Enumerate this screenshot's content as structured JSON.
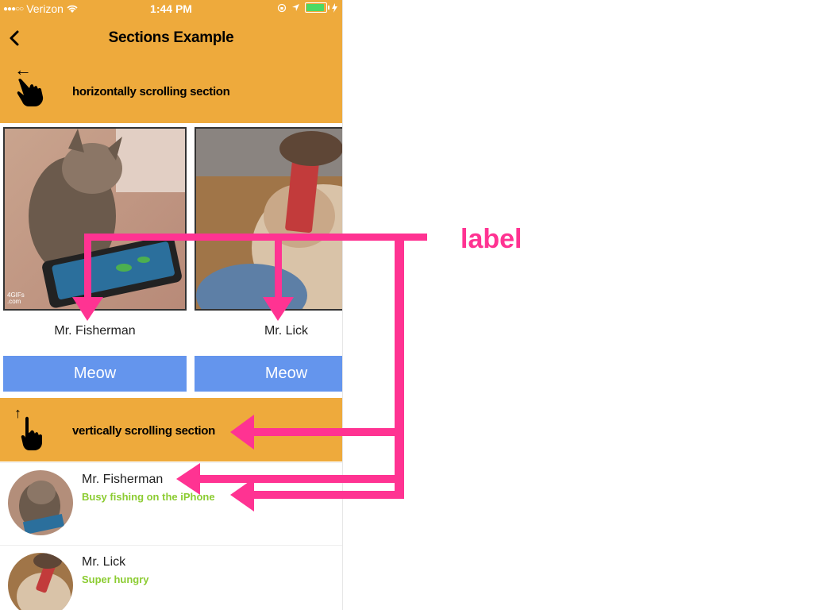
{
  "status_bar": {
    "carrier": "Verizon",
    "time": "1:44 PM",
    "icons": [
      "signal-dots-icon",
      "wifi-icon",
      "location-icon",
      "rotation-lock-icon",
      "battery-icon",
      "charging-icon"
    ]
  },
  "nav": {
    "title": "Sections Example",
    "back_icon": "chevron-left-icon"
  },
  "sections": {
    "horizontal": {
      "title": "horizontally scrolling section",
      "arrow": "←",
      "icon": "hand-swipe-icon"
    },
    "vertical": {
      "title": "vertically scrolling section",
      "arrow": "↑",
      "icon": "hand-swipe-icon"
    }
  },
  "cards": [
    {
      "name": "Mr. Fisherman",
      "button": "Meow",
      "watermark": "4GIFs\n.com"
    },
    {
      "name": "Mr. Lick",
      "button": "Meow"
    }
  ],
  "rows": [
    {
      "name": "Mr. Fisherman",
      "subtitle": "Busy fishing on the iPhone"
    },
    {
      "name": "Mr. Lick",
      "subtitle": "Super hungry"
    }
  ],
  "annotation": {
    "label": "label",
    "color": "#ff3392"
  },
  "colors": {
    "header_orange": "#eeaa3c",
    "button_blue": "#6495ed",
    "subtitle_green": "#8ccc32"
  }
}
